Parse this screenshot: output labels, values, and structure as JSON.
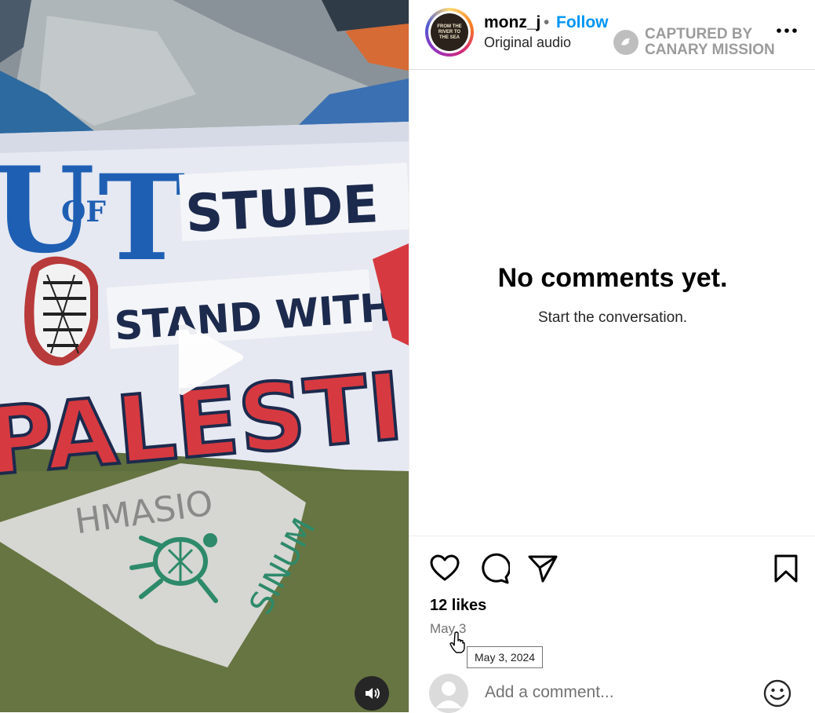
{
  "post": {
    "username": "monz_j",
    "separator": "•",
    "follow_label": "Follow",
    "audio_label": "Original audio",
    "avatar_text": "FROM THE RIVER TO THE SEA",
    "more_icon": "more-horizontal-icon"
  },
  "watermark": {
    "line1": "CAPTURED BY",
    "line2": "CANARY MISSION"
  },
  "media": {
    "banner_line1_a": "U",
    "banner_line1_b": "OF",
    "banner_line1_c": "T",
    "banner_line1_d": "STUDE",
    "banner_line2": "STAND WITH",
    "banner_line3": "PALESTI",
    "cloth_text_a": "HMASIO",
    "cloth_text_b": "SINUM",
    "play_icon": "play-icon",
    "volume_icon": "volume-icon"
  },
  "comments": {
    "empty_title": "No comments yet.",
    "empty_subtitle": "Start the conversation."
  },
  "actions": {
    "like_icon": "heart-icon",
    "comment_icon": "comment-icon",
    "share_icon": "send-icon",
    "save_icon": "bookmark-icon"
  },
  "stats": {
    "likes": "12 likes",
    "date": "May 3",
    "date_tooltip": "May 3, 2024"
  },
  "composer": {
    "placeholder": "Add a comment...",
    "emoji_icon": "emoji-icon"
  },
  "colors": {
    "accent": "#0095f6",
    "banner_blue": "#1f5fb3",
    "banner_navy": "#1c2a4d",
    "banner_red": "#d63a40"
  }
}
